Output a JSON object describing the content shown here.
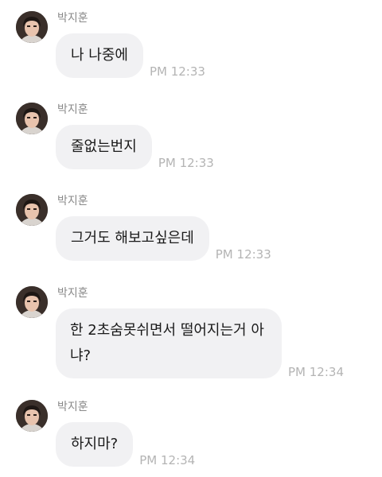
{
  "sender_name": "박지훈",
  "messages": [
    {
      "text": "나 나중에",
      "time": "PM 12:33"
    },
    {
      "text": "줄없는번지",
      "time": "PM 12:33"
    },
    {
      "text": "그거도 해보고싶은데",
      "time": "PM 12:33"
    },
    {
      "text": "한 2초숨못쉬면서 떨어지는거 아냐?",
      "time": "PM 12:34"
    },
    {
      "text": "하지마?",
      "time": "PM 12:34"
    }
  ],
  "colors": {
    "background": "#ffffff",
    "bubble": "#f1f1f3",
    "text": "#1a1a1a",
    "sender": "#8a8a8a",
    "time": "#b4b4b4"
  },
  "icons": {
    "avatar": "profile-photo"
  }
}
